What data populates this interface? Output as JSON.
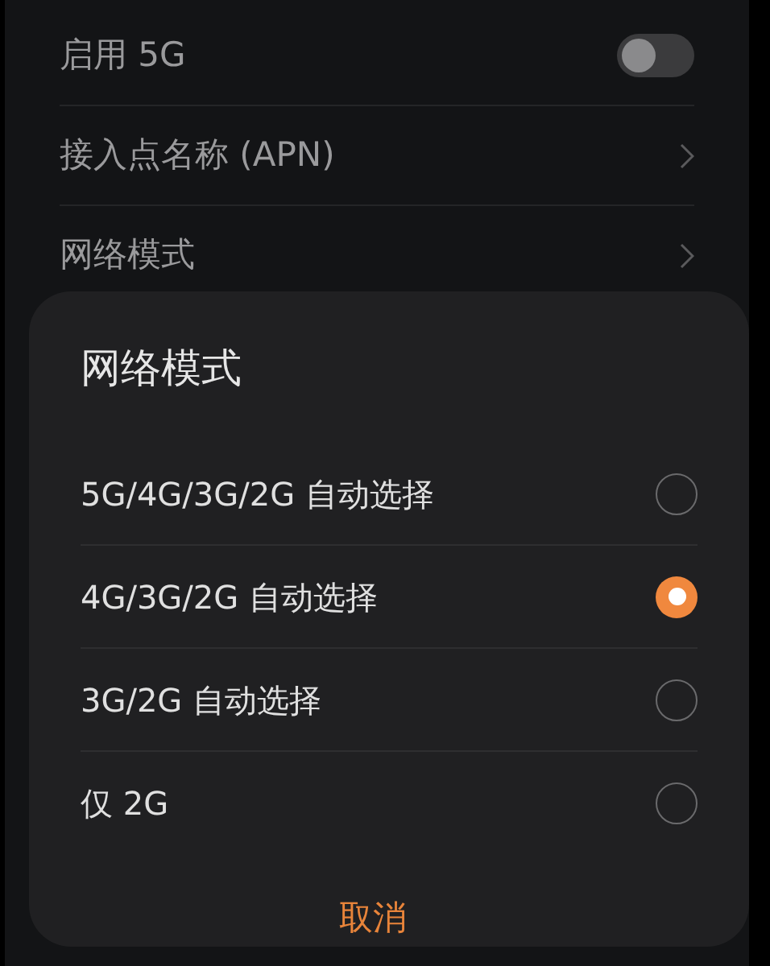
{
  "settings": [
    {
      "label": "启用 5G",
      "kind": "toggle",
      "on": false
    },
    {
      "label": "接入点名称 (APN)",
      "kind": "link"
    },
    {
      "label": "网络模式",
      "kind": "link"
    }
  ],
  "dialog": {
    "title": "网络模式",
    "options": [
      {
        "label": "5G/4G/3G/2G 自动选择",
        "selected": false
      },
      {
        "label": "4G/3G/2G 自动选择",
        "selected": true
      },
      {
        "label": "3G/2G 自动选择",
        "selected": false
      },
      {
        "label": "仅 2G",
        "selected": false
      }
    ],
    "cancel": "取消"
  }
}
